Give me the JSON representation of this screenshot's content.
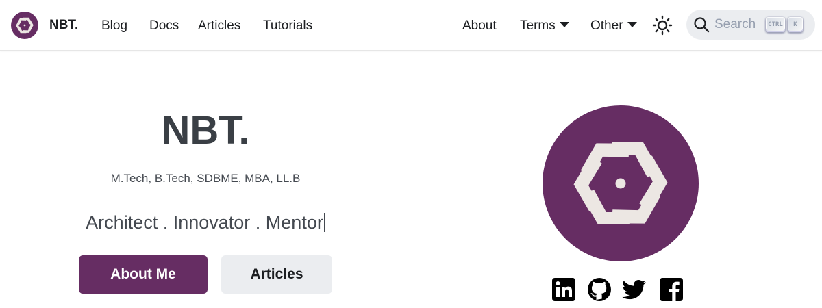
{
  "navbar": {
    "brand": "NBT.",
    "links_left": [
      "Blog",
      "Docs",
      "Articles",
      "Tutorials"
    ],
    "links_right": [
      "About",
      "Terms",
      "Other"
    ],
    "search": {
      "placeholder": "Search",
      "key_ctrl": "CTRL",
      "key_k": "K"
    }
  },
  "hero": {
    "title": "NBT.",
    "degrees": "M.Tech, B.Tech, SDBME, MBA, LL.B",
    "tagline": "Architect . Innovator . Mentor",
    "primary_button": "About Me",
    "secondary_button": "Articles"
  },
  "social": [
    "linkedin-icon",
    "github-icon",
    "twitter-icon",
    "facebook-icon"
  ],
  "colors": {
    "brand": "#662d63",
    "logo_mark": "#ece7e3",
    "button_secondary": "#ebedf0"
  }
}
